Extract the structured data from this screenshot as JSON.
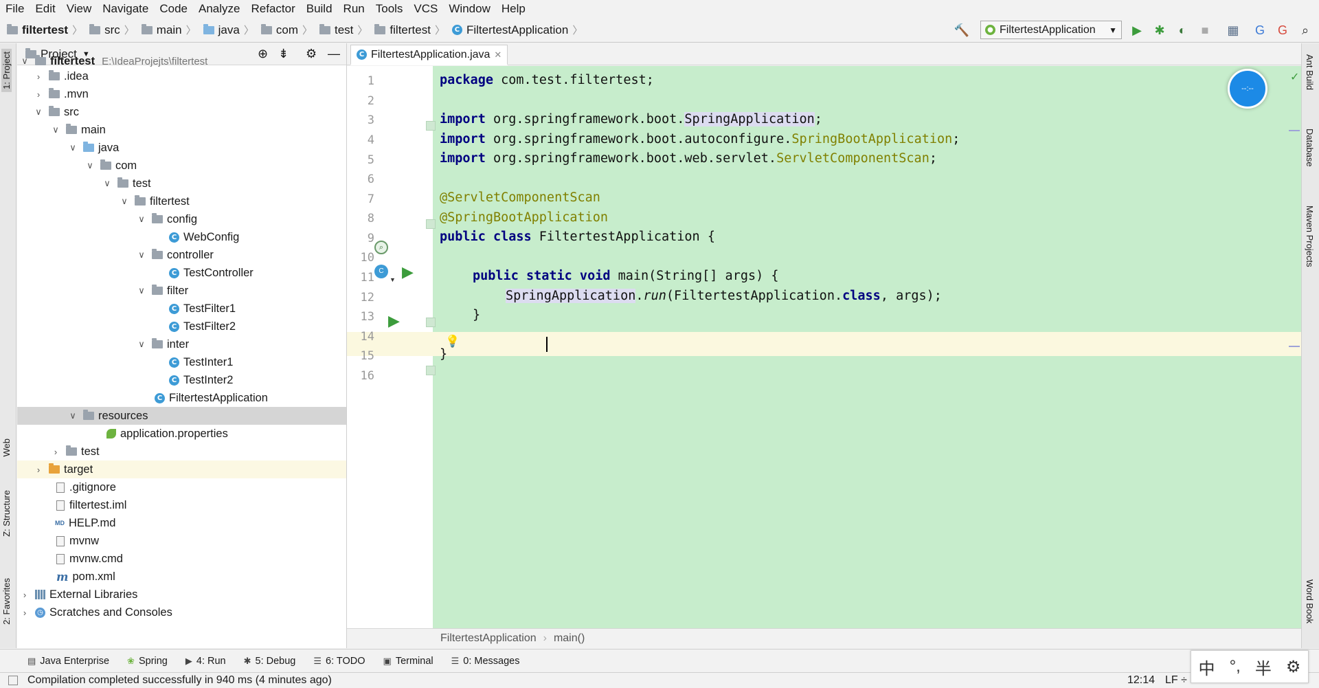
{
  "menu": [
    "File",
    "Edit",
    "View",
    "Navigate",
    "Code",
    "Analyze",
    "Refactor",
    "Build",
    "Run",
    "Tools",
    "VCS",
    "Window",
    "Help"
  ],
  "breadcrumb": [
    "filtertest",
    "src",
    "main",
    "java",
    "com",
    "test",
    "filtertest",
    "FiltertestApplication"
  ],
  "run_config": "FiltertestApplication",
  "project_panel": {
    "title": "Project",
    "tree": [
      {
        "label": "filtertest",
        "extra": "E:\\IdeaProjejts\\filtertest"
      },
      {
        "label": ".idea"
      },
      {
        "label": ".mvn"
      },
      {
        "label": "src"
      },
      {
        "label": "main"
      },
      {
        "label": "java"
      },
      {
        "label": "com"
      },
      {
        "label": "test"
      },
      {
        "label": "filtertest"
      },
      {
        "label": "config"
      },
      {
        "label": "WebConfig"
      },
      {
        "label": "controller"
      },
      {
        "label": "TestController"
      },
      {
        "label": "filter"
      },
      {
        "label": "TestFilter1"
      },
      {
        "label": "TestFilter2"
      },
      {
        "label": "inter"
      },
      {
        "label": "TestInter1"
      },
      {
        "label": "TestInter2"
      },
      {
        "label": "FiltertestApplication"
      },
      {
        "label": "resources"
      },
      {
        "label": "application.properties"
      },
      {
        "label": "test"
      },
      {
        "label": "target"
      },
      {
        "label": ".gitignore"
      },
      {
        "label": "filtertest.iml"
      },
      {
        "label": "HELP.md"
      },
      {
        "label": "mvnw"
      },
      {
        "label": "mvnw.cmd"
      },
      {
        "label": "pom.xml"
      },
      {
        "label": "External Libraries"
      },
      {
        "label": "Scratches and Consoles"
      }
    ]
  },
  "left_tabs": [
    "1: Project",
    "Web",
    "Z: Structure",
    "2: Favorites"
  ],
  "right_tabs": [
    "Ant Build",
    "Database",
    "Maven Projects",
    "Word Book"
  ],
  "editor": {
    "tab": "FiltertestApplication.java",
    "line_numbers": [
      "1",
      "2",
      "3",
      "4",
      "5",
      "6",
      "7",
      "8",
      "9",
      "10",
      "11",
      "12",
      "13",
      "14",
      "15",
      "16"
    ],
    "code": {
      "l1_kw": "package",
      "l1_rest": " com.test.filtertest;",
      "import_kw": "import",
      "l3_pkg": " org.springframework.boot.",
      "l3_cls": "SpringApplication",
      "l4_pkg": " org.springframework.boot.autoconfigure.",
      "l4_cls": "SpringBootApplication",
      "l5_pkg": " org.springframework.boot.web.servlet.",
      "l5_cls": "ServletComponentScan",
      "semi": ";",
      "l7": "@ServletComponentScan",
      "l8": "@SpringBootApplication",
      "l9_kw": "public class",
      "l9_rest": " FiltertestApplication {",
      "l11_kw": "public static void",
      "l11_rest": " main(String[] args) {",
      "l12_cls": "SpringApplication",
      "l12_dot": ".",
      "l12_method": "run",
      "l12_arg": "(FiltertestApplication.",
      "l12_kw": "class",
      "l12_end": ", args);",
      "l13": "}",
      "l15": "}"
    },
    "breadcrumb": [
      "FiltertestApplication",
      "main()"
    ]
  },
  "tool_tabs": [
    {
      "icon": "▤",
      "label": "Java Enterprise"
    },
    {
      "icon": "❀",
      "label": "Spring"
    },
    {
      "icon": "▶",
      "label": "4: Run"
    },
    {
      "icon": "✱",
      "label": "5: Debug"
    },
    {
      "icon": "☰",
      "label": "6: TODO"
    },
    {
      "icon": "▣",
      "label": "Terminal"
    },
    {
      "icon": "☰",
      "label": "0: Messages"
    }
  ],
  "status": {
    "message": "Compilation completed successfully in 940 ms (4 minutes ago)",
    "position": "12:14",
    "line_sep": "LF ÷"
  },
  "ime": {
    "a": "中",
    "b": "°,",
    "c": "半",
    "d": "⚙"
  },
  "float_label": "--:--",
  "colors": {
    "editor_bg": "#c7edcc",
    "current_line": "#fbf8df",
    "keyword": "#000080",
    "annotation": "#808000"
  }
}
